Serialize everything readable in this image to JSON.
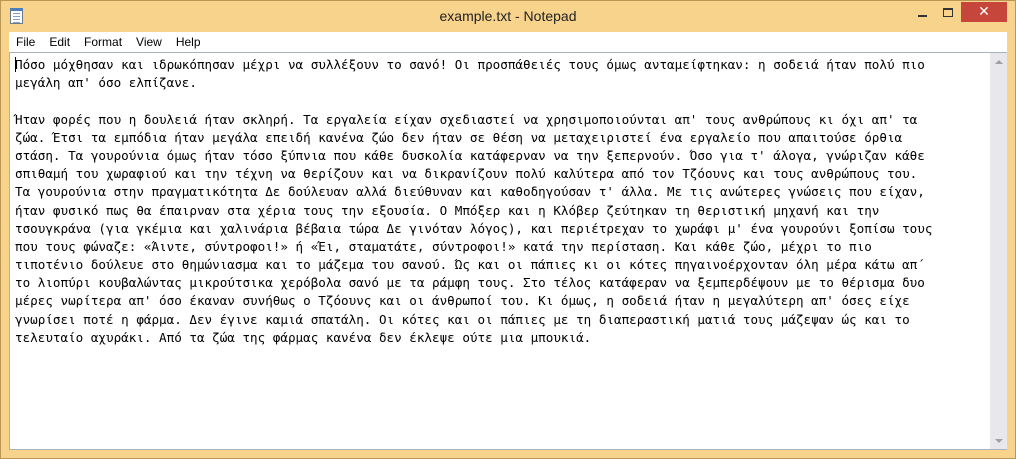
{
  "window": {
    "title": "example.txt - Notepad",
    "icon": "notepad-icon",
    "controls": {
      "minimize_icon": "minimize-icon",
      "maximize_icon": "maximize-icon",
      "close_icon": "close-icon",
      "close_glyph": "✕"
    },
    "accent_color": "#f8d38c",
    "close_color": "#c7463b"
  },
  "menu": {
    "items": [
      {
        "label": "File"
      },
      {
        "label": "Edit"
      },
      {
        "label": "Format"
      },
      {
        "label": "View"
      },
      {
        "label": "Help"
      }
    ]
  },
  "document": {
    "lines": [
      "Πόσο μόχθησαν και ιδρωκόπησαν μέχρι να συλλέξουν το σανό! Οι προσπάθειές τους όμως ανταμείφτηκαν: η σοδειά ήταν πολύ πιο",
      "μεγάλη απ' όσο ελπίζανε.",
      "",
      "Ήταν φορές που η δουλειά ήταν σκληρή. Τα εργαλεία είχαν σχεδιαστεί να χρησιμοποιούνται απ' τους ανθρώπους κι όχι απ' τα",
      "ζώα. Έτσι τα εμπόδια ήταν μεγάλα επειδή κανένα ζώο δεν ήταν σε θέση να μεταχειριστεί ένα εργαλείο που απαιτούσε όρθια",
      "στάση. Τα γουρούνια όμως ήταν τόσο ξύπνια που κάθε δυσκολία κατάφερναν να την ξεπερνούν. Όσο για τ' άλογα, γνώριζαν κάθε",
      "σπιθαμή του χωραφιού και την τέχνη να θερίζουν και να δικρανίζουν πολύ καλύτερα από τον Τζόουνς και τους ανθρώπους του.",
      "Τα γουρούνια στην πραγματικότητα Δε δούλευαν αλλά διεύθυναν και καθοδηγούσαν τ' άλλα. Με τις ανώτερες γνώσεις που είχαν,",
      "ήταν φυσικό πως θα έπαιρναν στα χέρια τους την εξουσία. Ο Μπόξερ και η Κλόβερ ζεύτηκαν τη θεριστική μηχανή και την",
      "τσουγκράνα (για γκέμια και χαλινάρια βέβαια τώρα Δε γινόταν λόγος), και περιέτρεχαν το χωράφι μ' ένα γουρούνι ξοπίσω τους",
      "που τους φώναζε: «Άιντε, σύντροφοι!» ή «Έι, σταματάτε, σύντροφοι!» κατά την περίσταση. Και κάθε ζώο, μέχρι το πιο",
      "τιποτένιο δούλευε στο θημώνιασμα και το μάζεμα του σανού. Ώς και οι πάπιες κι οι κότες πηγαινοέρχονταν όλη μέρα κάτω απ΄",
      "το λιοπύρι κουβαλώντας μικρούτσικα χερόβολα σανό με τα ράμφη τους. Στο τέλος κατάφεραν να ξεμπερδέψουν με το θέρισμα δυο",
      "μέρες νωρίτερα απ' όσο έκαναν συνήθως ο Τζόουνς και οι άνθρωποί του. Κι όμως, η σοδειά ήταν η μεγαλύτερη απ' όσες είχε",
      "γνωρίσει ποτέ η φάρμα. Δεν έγινε καμιά σπατάλη. Οι κότες και οι πάπιες με τη διαπεραστική ματιά τους μάζεψαν ώς και το",
      "τελευταίο αχυράκι. Από τα ζώα της φάρμας κανένα δεν έκλεψε ούτε μια μπουκιά."
    ]
  },
  "scrollbar": {
    "up_icon": "scroll-up-arrow-icon",
    "down_icon": "scroll-down-arrow-icon"
  }
}
